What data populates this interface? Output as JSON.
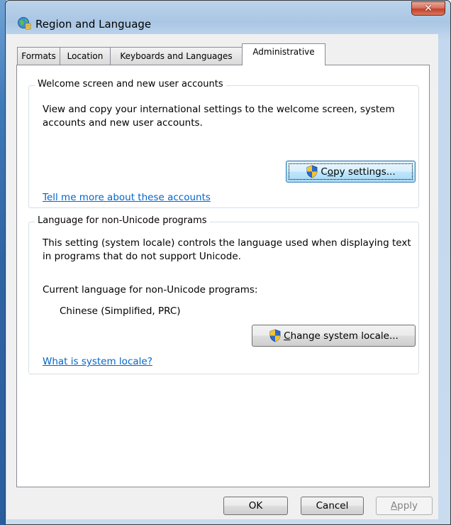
{
  "window": {
    "title": "Region and Language",
    "close_glyph": "✕"
  },
  "tabs": [
    {
      "label": "Formats",
      "active": false
    },
    {
      "label": "Location",
      "active": false
    },
    {
      "label": "Keyboards and Languages",
      "active": false
    },
    {
      "label": "Administrative",
      "active": true
    }
  ],
  "welcome_group": {
    "legend": "Welcome screen and new user accounts",
    "description": "View and copy your international settings to the welcome screen, system accounts and new user accounts.",
    "copy_button": {
      "prefix": "C",
      "mnemonic": "o",
      "suffix": "py settings...",
      "icon": "uac-shield-icon"
    },
    "link": "Tell me more about these accounts"
  },
  "locale_group": {
    "legend": "Language for non-Unicode programs",
    "description": "This setting (system locale) controls the language used when displaying text in programs that do not support Unicode.",
    "current_label": "Current language for non-Unicode programs:",
    "current_value": "Chinese (Simplified, PRC)",
    "change_button": {
      "prefix": "",
      "mnemonic": "C",
      "suffix": "hange system locale...",
      "icon": "uac-shield-icon"
    },
    "link": "What is system locale?"
  },
  "footer": {
    "ok_label": "OK",
    "cancel_label": "Cancel",
    "apply_prefix": "",
    "apply_mnemonic": "A",
    "apply_suffix": "pply"
  },
  "colors": {
    "link": "#0066cc",
    "title_bar": "#a9c6e4",
    "close_button": "#c4402a"
  }
}
